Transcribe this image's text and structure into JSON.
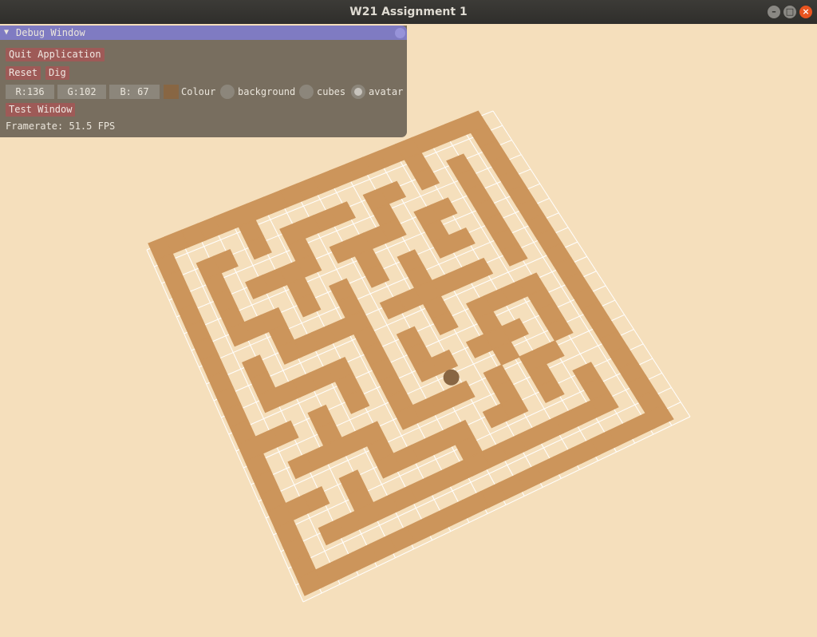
{
  "window": {
    "title": "W21 Assignment 1",
    "minimize_glyph": "–",
    "maximize_glyph": "□",
    "close_glyph": "×"
  },
  "debug_window": {
    "title": "Debug Window",
    "collapse_glyph": "▼",
    "quit_label": "Quit Application",
    "reset_label": "Reset",
    "dig_label": "Dig",
    "r_value": "R:136",
    "g_value": "G:102",
    "b_value": "B: 67",
    "colour_label": "Colour",
    "swatch_color": "#886643",
    "radio_options": [
      "background",
      "cubes",
      "avatar"
    ],
    "selected_option": "avatar",
    "test_window_label": "Test Window",
    "framerate": "Framerate: 51.5 FPS"
  },
  "scene": {
    "background_color": "#f5dfbc",
    "cube_color": "#cc955b",
    "grid_color": "#ffffff",
    "avatar_color": "#886643",
    "grid_size": 21,
    "maze_rows": [
      "XXXXXXXXXXXXXXXXXXXX.",
      "X....X.........X...X.",
      "X.XX.X.XXXX.XX.X.X.X.",
      "X.X....X....X....X.X.",
      "X.X.XXXX.XXXX.XX.X.X.",
      "X.X...X...X...X..X.X.",
      "X.XXX.X.X.X.X.XX.X.X.",
      "X...X...X...X....X.X.",
      "X.X.XXXXX.XXXXXX.X.X.",
      "X.X.....X...X......X.",
      "X.XXXXX.X.X.X.XXXX.X.",
      "X.....X.X.X...X..X.X.",
      "XXX.X.X.X.XX.XXX.X.X.",
      "X...X...X.....X..X.X.",
      "X.XXXXX.XXXX.X.XX..X.",
      "X.....X......X.X...X.",
      "XXX.X.XXXXX.XX.X.X.X.",
      "X...X.....X......X.X.",
      "X.XXXXXXXXXXXXXXXX.X.",
      "X..................X.",
      "XXXXXXXXXXXXXXXXXXXX."
    ],
    "avatar_cell": [
      11,
      13
    ]
  }
}
